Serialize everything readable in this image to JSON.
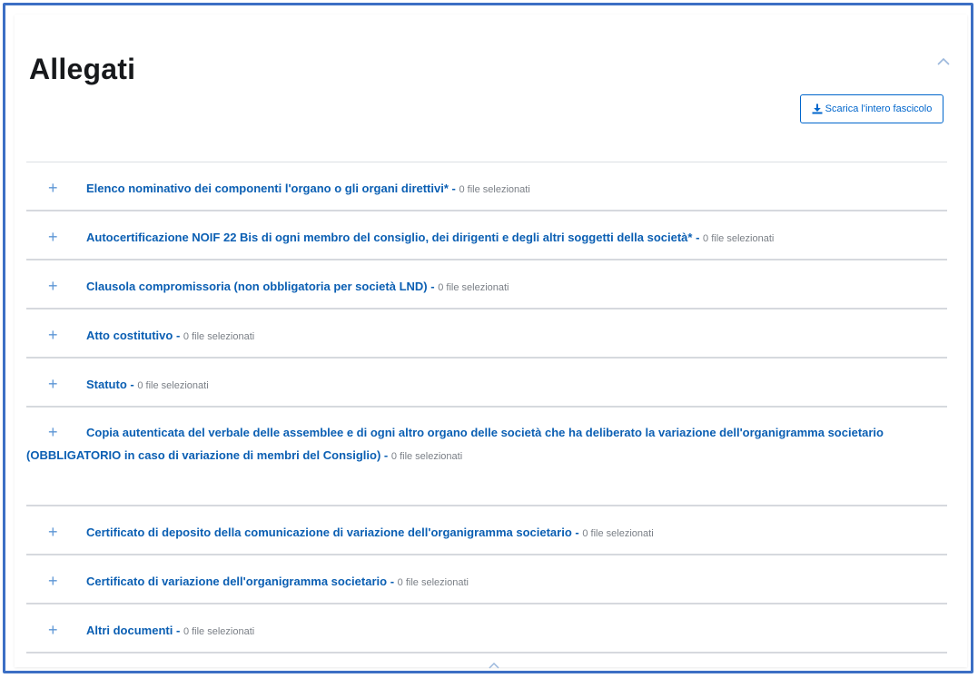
{
  "section": {
    "title": "Allegati",
    "download_label": "Scarica l'intero fascicolo"
  },
  "separator": "-",
  "items": [
    {
      "label": "Elenco nominativo dei componenti l'organo o gli organi direttivi*",
      "count": "0 file selezionati"
    },
    {
      "label": "Autocertificazione NOIF 22 Bis di ogni membro del consiglio, dei dirigenti e degli altri soggetti della società*",
      "count": "0 file selezionati"
    },
    {
      "label": "Clausola compromissoria (non obbligatoria per società LND)",
      "count": "0 file selezionati"
    },
    {
      "label": "Atto costitutivo",
      "count": "0 file selezionati"
    },
    {
      "label": "Statuto",
      "count": "0 file selezionati"
    },
    {
      "label": "Copia autenticata del verbale delle assemblee e di ogni altro organo delle società che ha deliberato la variazione dell'organigramma societario (OBBLIGATORIO in caso di variazione di membri del Consiglio)",
      "count": "0 file selezionati"
    },
    {
      "label": "Certificato di deposito della comunicazione di variazione dell'organigramma societario",
      "count": "0 file selezionati"
    },
    {
      "label": "Certificato di variazione dell'organigramma societario",
      "count": "0 file selezionati"
    },
    {
      "label": "Altri documenti",
      "count": "0 file selezionati"
    }
  ],
  "icons": {
    "expand": "plus-icon",
    "collapse": "chevron-up-icon",
    "download": "download-icon"
  },
  "colors": {
    "accent": "#0066cc",
    "frame": "#3c6fc4",
    "muted_text": "#7a7f86",
    "divider": "#d6d9de"
  }
}
